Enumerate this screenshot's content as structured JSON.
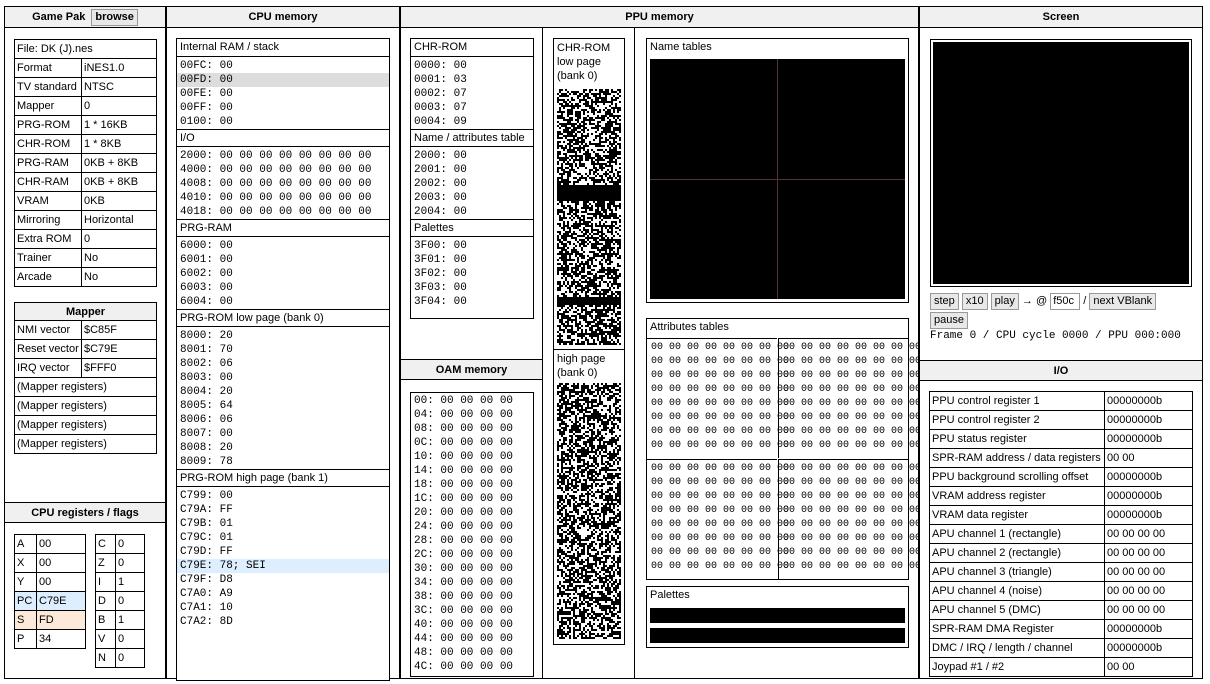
{
  "gamepak": {
    "title": "Game Pak",
    "browse": "browse",
    "rows": [
      [
        "File: DK (J).nes",
        ""
      ],
      [
        "Format",
        "iNES1.0"
      ],
      [
        "TV standard",
        "NTSC"
      ],
      [
        "Mapper",
        "0"
      ],
      [
        "PRG-ROM",
        "1 * 16KB"
      ],
      [
        "CHR-ROM",
        "1 * 8KB"
      ],
      [
        "PRG-RAM",
        "0KB + 8KB"
      ],
      [
        "CHR-RAM",
        "0KB + 8KB"
      ],
      [
        "VRAM",
        "0KB"
      ],
      [
        "Mirroring",
        "Horizontal"
      ],
      [
        "Extra ROM",
        "0"
      ],
      [
        "Trainer",
        "No"
      ],
      [
        "Arcade",
        "No"
      ]
    ]
  },
  "mapper": {
    "title": "Mapper",
    "rows": [
      [
        "NMI vector",
        "$C85F"
      ],
      [
        "Reset vector",
        "$C79E"
      ],
      [
        "IRQ vector",
        "$FFF0"
      ],
      [
        "(Mapper registers)",
        ""
      ],
      [
        "(Mapper registers)",
        ""
      ],
      [
        "(Mapper registers)",
        ""
      ],
      [
        "(Mapper registers)",
        ""
      ]
    ]
  },
  "cpuregs": {
    "title": "CPU registers / flags",
    "regs": [
      [
        "A",
        "00"
      ],
      [
        "X",
        "00"
      ],
      [
        "Y",
        "00"
      ],
      [
        "PC",
        "C79E"
      ],
      [
        "S",
        "FD"
      ],
      [
        "P",
        "34"
      ]
    ],
    "flags": [
      [
        "C",
        "0"
      ],
      [
        "Z",
        "0"
      ],
      [
        "I",
        "1"
      ],
      [
        "D",
        "0"
      ],
      [
        "B",
        "1"
      ],
      [
        "V",
        "0"
      ],
      [
        "N",
        "0"
      ]
    ]
  },
  "cpumem": {
    "title": "CPU memory",
    "ram": {
      "title": "Internal RAM / stack",
      "rows": [
        "00FC: 00",
        "00FD: 00",
        "00FE: 00",
        "00FF: 00",
        "0100: 00"
      ]
    },
    "io": {
      "title": "I/O",
      "rows": [
        "2000: 00 00 00 00 00 00 00 00",
        "4000: 00 00 00 00 00 00 00 00",
        "4008: 00 00 00 00 00 00 00 00",
        "4010: 00 00 00 00 00 00 00 00",
        "4018: 00 00 00 00 00 00 00 00"
      ]
    },
    "prgram": {
      "title": "PRG-RAM",
      "rows": [
        "6000: 00",
        "6001: 00",
        "6002: 00",
        "6003: 00",
        "6004: 00"
      ]
    },
    "prglow": {
      "title": "PRG-ROM low page (bank 0)",
      "rows": [
        "8000: 20",
        "8001: 70",
        "8002: 06",
        "8003: 00",
        "8004: 20",
        "8005: 64",
        "8006: 06",
        "8007: 00",
        "8008: 20",
        "8009: 78"
      ]
    },
    "prghigh": {
      "title": "PRG-ROM high page (bank 1)",
      "rows": [
        "C799: 00",
        "C79A: FF",
        "C79B: 01",
        "C79C: 01",
        "C79D: FF",
        "C79E: 78; SEI",
        "C79F: D8",
        "C7A0: A9",
        "C7A1: 10",
        "C7A2: 8D"
      ]
    }
  },
  "ppumem": {
    "title": "PPU memory",
    "chrrom": {
      "title": "CHR-ROM",
      "rows": [
        "0000: 00",
        "0001: 03",
        "0002: 07",
        "0003: 07",
        "0004: 09"
      ]
    },
    "nametbl": {
      "title": "Name / attributes table",
      "rows": [
        "2000: 00",
        "2001: 00",
        "2002: 00",
        "2003: 00",
        "2004: 00"
      ]
    },
    "palettes": {
      "title": "Palettes",
      "rows": [
        "3F00: 00",
        "3F01: 00",
        "3F02: 00",
        "3F03: 00",
        "3F04: 00"
      ]
    },
    "chrlow": "CHR-ROM low page (bank 0)",
    "chrhigh": "high page (bank 0)",
    "nametables": "Name tables",
    "attrtables": "Attributes tables",
    "attrrow": "00 00 00 00 00 00 00 00",
    "palettes2": "Palettes"
  },
  "oam": {
    "title": "OAM memory",
    "rows": [
      "00: 00 00 00 00",
      "04: 00 00 00 00",
      "08: 00 00 00 00",
      "0C: 00 00 00 00",
      "10: 00 00 00 00",
      "14: 00 00 00 00",
      "18: 00 00 00 00",
      "1C: 00 00 00 00",
      "20: 00 00 00 00",
      "24: 00 00 00 00",
      "28: 00 00 00 00",
      "2C: 00 00 00 00",
      "30: 00 00 00 00",
      "34: 00 00 00 00",
      "38: 00 00 00 00",
      "3C: 00 00 00 00",
      "40: 00 00 00 00",
      "44: 00 00 00 00",
      "48: 00 00 00 00",
      "4C: 00 00 00 00"
    ]
  },
  "screen": {
    "title": "Screen",
    "step": "step",
    "x10": "x10",
    "play": "play",
    "arrow": "→ @",
    "frame": "f50c",
    "slash": "/",
    "nextvblank": "next VBlank",
    "pause": "pause",
    "status": "Frame 0 / CPU cycle 0000 / PPU 000:000"
  },
  "io": {
    "title": "I/O",
    "rows": [
      [
        "PPU control register 1",
        "00000000b"
      ],
      [
        "PPU control register 2",
        "00000000b"
      ],
      [
        "PPU status register",
        "00000000b"
      ],
      [
        "SPR-RAM address / data registers",
        "00 00"
      ],
      [
        "PPU background scrolling offset",
        "00000000b"
      ],
      [
        "VRAM address register",
        "00000000b"
      ],
      [
        "VRAM data register",
        "00000000b"
      ],
      [
        "APU channel 1 (rectangle)",
        "00 00 00 00"
      ],
      [
        "APU channel 2 (rectangle)",
        "00 00 00 00"
      ],
      [
        "APU channel 3 (triangle)",
        "00 00 00 00"
      ],
      [
        "APU channel 4 (noise)",
        "00 00 00 00"
      ],
      [
        "APU channel 5 (DMC)",
        "00 00 00 00"
      ],
      [
        "SPR-RAM DMA Register",
        "00000000b"
      ],
      [
        "DMC / IRQ / length / channel",
        "00000000b"
      ],
      [
        "Joypad #1 / #2",
        "00 00"
      ]
    ]
  },
  "colors": {
    "selGray": "#dddddd",
    "selBlue": "#ddeeff",
    "selOrange": "#fde9d9"
  }
}
